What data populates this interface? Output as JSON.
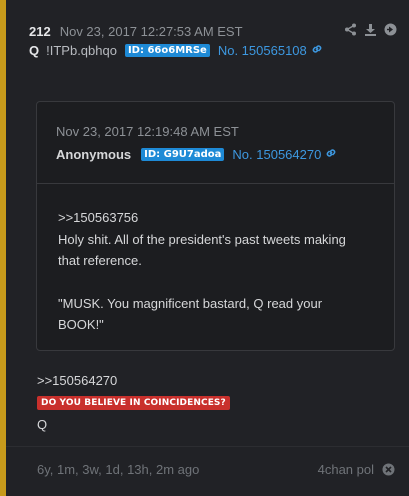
{
  "post": {
    "number": "212",
    "timestamp": "Nov 23, 2017 12:27:53 AM EST",
    "name": "Q",
    "tripcode": "!ITPb.qbhqo",
    "id_label": "ID: 66o6MRSe",
    "post_no": "No. 150565108"
  },
  "quoted": {
    "timestamp": "Nov 23, 2017 12:19:48 AM EST",
    "name": "Anonymous",
    "id_label": "ID: G9U7adoa",
    "post_no": "No. 150564270",
    "lines": [
      ">>150563756",
      "Holy shit. All of the president's past tweets making",
      "that reference.",
      "\"MUSK. You magnificent bastard, Q read your",
      "BOOK!\""
    ]
  },
  "reply": {
    "ref": ">>150564270",
    "badge": "DO YOU BELIEVE IN COINCIDENCES?",
    "signature": "Q"
  },
  "footer": {
    "age": "6y, 1m, 3w, 1d, 13h, 2m ago",
    "source": "4chan pol"
  },
  "colors": {
    "accent_border": "#c79a1b",
    "id_badge": "#1e8ad6",
    "link": "#3d98e0",
    "alert_badge": "#c9302c"
  },
  "icons": [
    "share-icon",
    "download-icon",
    "next-arrow-icon",
    "link-icon",
    "close-circle-icon"
  ]
}
